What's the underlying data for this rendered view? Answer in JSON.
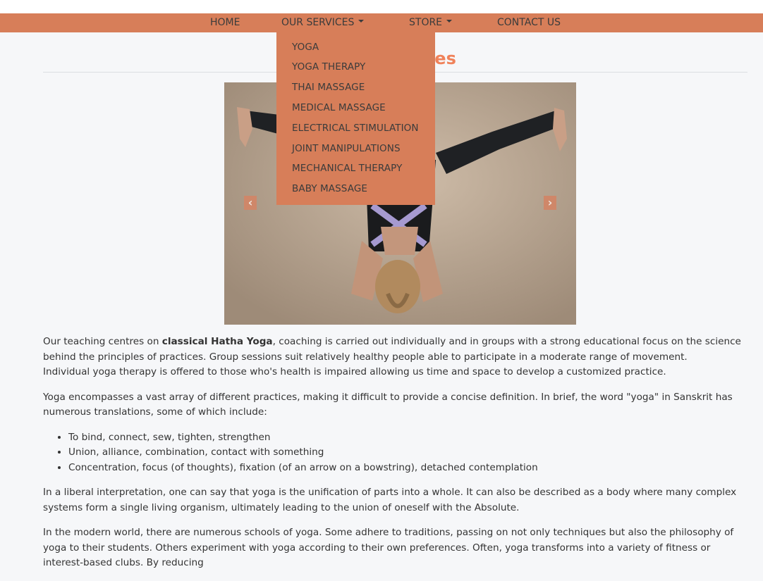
{
  "nav": {
    "home": "HOME",
    "services": "OUR SERVICES",
    "store": "STORE",
    "contact": "CONTACT US"
  },
  "services_menu": [
    "YOGA",
    "YOGA THERAPY",
    "THAI MASSAGE",
    "MEDICAL MASSAGE",
    "ELECTRICAL STIMULATION",
    "JOINT MANIPULATIONS",
    "MECHANICAL THERAPY",
    "BABY MASSAGE"
  ],
  "page": {
    "title": "Our Services"
  },
  "carousel": {
    "prev": "‹",
    "next": "›"
  },
  "content": {
    "p1_a": "Our teaching centres on ",
    "p1_bold": "classical Hatha Yoga",
    "p1_b": ", coaching is carried out individually and in groups with a strong educational focus on the science behind the principles of practices. Group sessions suit relatively healthy people able to participate in a moderate range of movement.",
    "p1_c": "Individual yoga therapy is offered to those who's health is impaired allowing us time and space to develop a customized practice.",
    "p2": "Yoga encompasses a vast array of different practices, making it difficult to provide a concise definition. In brief, the word \"yoga\" in Sanskrit has numerous translations, some of which include:",
    "list": [
      "To bind, connect, sew, tighten, strengthen",
      "Union, alliance, combination, contact with something",
      "Concentration, focus (of thoughts), fixation (of an arrow on a bowstring), detached contemplation"
    ],
    "p3": "In a liberal interpretation, one can say that yoga is the unification of parts into a whole. It can also be described as a body where many complex systems form a single living organism, ultimately leading to the union of oneself with the Absolute.",
    "p4": "In the modern world, there are numerous schools of yoga. Some adhere to traditions, passing on not only techniques but also the philosophy of yoga to their students. Others experiment with yoga according to their own preferences. Often, yoga transforms into a variety of fitness or interest-based clubs. By reducing"
  },
  "colors": {
    "nav_bg": "#d77e59",
    "title": "#f0825a",
    "page_bg": "#f6f7f9"
  }
}
